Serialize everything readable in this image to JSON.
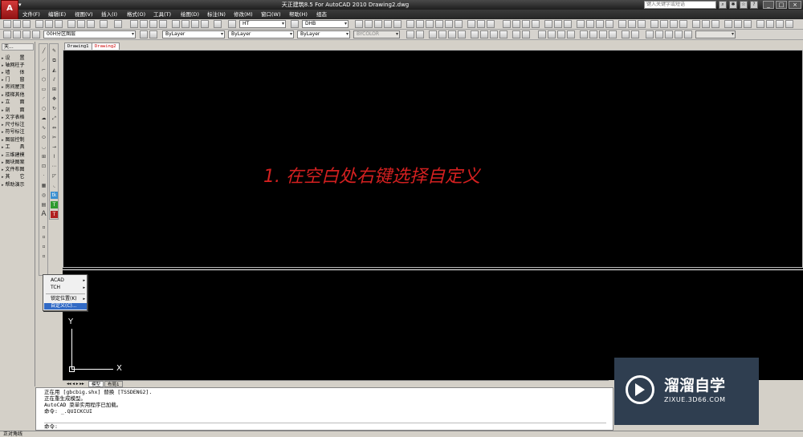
{
  "app": {
    "logo": "A",
    "title": "天正建筑8.5 For AutoCAD 2010    Drawing2.dwg",
    "search_placeholder": "键入关键字或短语"
  },
  "menu": [
    "文件(F)",
    "编辑(E)",
    "视图(V)",
    "插入(I)",
    "格式(O)",
    "工具(T)",
    "绘图(D)",
    "标注(N)",
    "修改(M)",
    "窗口(W)",
    "帮助(H)",
    "组态"
  ],
  "toolbar": {
    "textstyle": "HT",
    "dimstyle": "DHB",
    "layer": "00H分区图层",
    "color": "ByLayer",
    "linetype": "ByLayer",
    "lineweight": "ByLayer",
    "plotstyle": "BYCOLOR"
  },
  "left_panel": {
    "title": "天...",
    "items": [
      "设　　置",
      "轴网柱子",
      "墙　　体",
      "门　　窗",
      "房间屋顶",
      "楼梯其他",
      "立　　面",
      "剖　　面",
      "文字表格",
      "尺寸标注",
      "符号标注",
      "图层控制",
      "工　　具",
      "三维建模",
      "图块图案",
      "文件布图",
      "其　　它",
      "帮助演示"
    ]
  },
  "doc_tabs": [
    "Drawing1",
    "Drawing2"
  ],
  "annotation": "1. 在空白处右键选择自定义",
  "context_menu": [
    {
      "label": "ACAD",
      "submenu": true
    },
    {
      "label": "TCH",
      "submenu": true
    },
    {
      "label": "锁定位置(K)",
      "submenu": true
    },
    {
      "label": "自定义(C)...",
      "submenu": false
    }
  ],
  "ucs": {
    "x": "X",
    "y": "Y"
  },
  "layout_tabs": [
    "模型",
    "布局1"
  ],
  "command_history": [
    "正在用 [gbcbig.shx] 替换 [TSSDENG2].",
    "正在重生成模型。",
    "AutoCAD 菜单实用程序已加载。",
    "命令: _.QUICKCUI"
  ],
  "command_prompt": "命令:",
  "watermark": {
    "name": "溜溜自学",
    "url": "ZIXUE.3D66.COM"
  },
  "status": "正对角线"
}
